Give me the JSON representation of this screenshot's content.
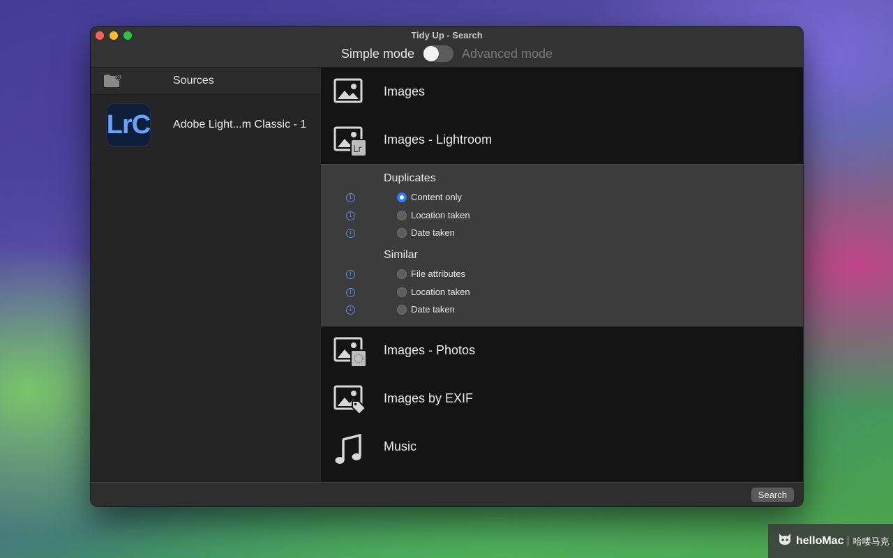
{
  "window": {
    "title": "Tidy Up - Search",
    "mode_left": "Simple mode",
    "mode_right": "Advanced mode",
    "mode_toggle_on": false
  },
  "sidebar": {
    "header_label": "Sources",
    "items": [
      {
        "icon_text": "LrC",
        "label": "Adobe Light...m Classic - 1"
      }
    ]
  },
  "main": {
    "rows": [
      {
        "icon": "image-icon",
        "label": "Images"
      },
      {
        "icon": "image-lightroom-icon",
        "label": "Images - Lightroom",
        "badge": "Lr"
      },
      {
        "icon": "image-photos-icon",
        "label": "Images - Photos"
      },
      {
        "icon": "image-exif-icon",
        "label": "Images by EXIF"
      },
      {
        "icon": "music-note-icon",
        "label": "Music"
      }
    ],
    "expanded": {
      "groups": [
        {
          "title": "Duplicates",
          "options": [
            {
              "label": "Content only",
              "selected": true
            },
            {
              "label": "Location taken",
              "selected": false
            },
            {
              "label": "Date taken",
              "selected": false
            }
          ]
        },
        {
          "title": "Similar",
          "options": [
            {
              "label": "File attributes",
              "selected": false
            },
            {
              "label": "Location taken",
              "selected": false
            },
            {
              "label": "Date taken",
              "selected": false
            }
          ]
        }
      ]
    }
  },
  "footer": {
    "search_label": "Search"
  },
  "watermark": {
    "brand": "helloMac",
    "cn": "哈喽马克"
  },
  "colors": {
    "accent": "#2f7bf5",
    "info": "#5b8fe0"
  }
}
